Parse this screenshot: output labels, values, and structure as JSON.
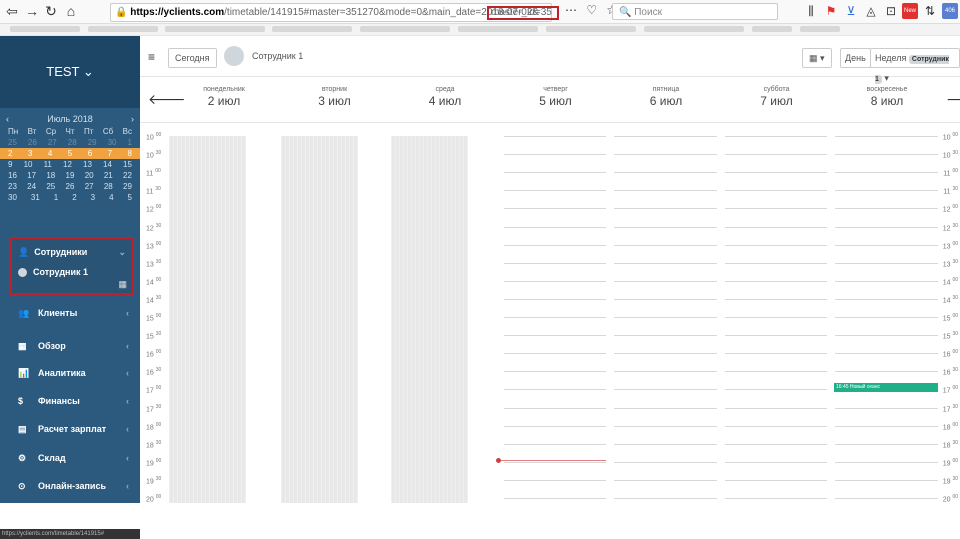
{
  "browser": {
    "url_domain": "https://yclients.com",
    "url_path": "/timetable/141915#master=351270&mode=0&main_date=2018-07-02&",
    "url_highlight": "master_id=35",
    "search_placeholder": "Поиск",
    "new_badge": "New",
    "count_badge": "406"
  },
  "sidebar": {
    "brand": "TEST ⌄",
    "calendar": {
      "month": "Июль 2018",
      "prev": "‹",
      "next": "›",
      "weekdays": [
        "Пн",
        "Вт",
        "Ср",
        "Чт",
        "Пт",
        "Сб",
        "Вс"
      ],
      "weeks": [
        {
          "days": [
            "25",
            "26",
            "27",
            "28",
            "29",
            "30",
            "1"
          ],
          "style": "dim"
        },
        {
          "days": [
            "2",
            "3",
            "4",
            "5",
            "6",
            "7",
            "8"
          ],
          "style": "current"
        },
        {
          "days": [
            "9",
            "10",
            "11",
            "12",
            "13",
            "14",
            "15"
          ],
          "style": ""
        },
        {
          "days": [
            "16",
            "17",
            "18",
            "19",
            "20",
            "21",
            "22"
          ],
          "style": ""
        },
        {
          "days": [
            "23",
            "24",
            "25",
            "26",
            "27",
            "28",
            "29"
          ],
          "style": ""
        },
        {
          "days": [
            "30",
            "31",
            "1",
            "2",
            "3",
            "4",
            "5"
          ],
          "style": ""
        }
      ]
    },
    "staff_header": "Сотрудники",
    "staff_member": "Сотрудник 1",
    "menu": [
      {
        "label": "Клиенты",
        "icon": "👥"
      },
      {
        "label": "Обзор",
        "icon": "▦"
      },
      {
        "label": "Аналитика",
        "icon": "📊"
      },
      {
        "label": "Финансы",
        "icon": "$"
      },
      {
        "label": "Расчет зарплат",
        "icon": "▤"
      },
      {
        "label": "Склад",
        "icon": "⚙"
      },
      {
        "label": "Онлайн-запись",
        "icon": "⊙"
      }
    ],
    "status_url": "https://yclients.com/timetable/141915#"
  },
  "toolbar": {
    "today": "Сегодня",
    "staff_name": "Сотрудник 1",
    "calendar_btn": "▦ ▾",
    "day": "День",
    "week": "Неделя",
    "week_badge": "Сотрудник 1",
    "week_caret": "▾"
  },
  "days": [
    {
      "weekday": "понедельник",
      "date": "2 июл"
    },
    {
      "weekday": "вторник",
      "date": "3 июл"
    },
    {
      "weekday": "среда",
      "date": "4 июл"
    },
    {
      "weekday": "четверг",
      "date": "5 июл"
    },
    {
      "weekday": "пятница",
      "date": "6 июл"
    },
    {
      "weekday": "суббота",
      "date": "7 июл"
    },
    {
      "weekday": "воскресенье",
      "date": "8 июл"
    }
  ],
  "times": [
    {
      "h": "10",
      "m": "00"
    },
    {
      "h": "10",
      "m": "30"
    },
    {
      "h": "11",
      "m": "00"
    },
    {
      "h": "11",
      "m": "30"
    },
    {
      "h": "12",
      "m": "00"
    },
    {
      "h": "12",
      "m": "30"
    },
    {
      "h": "13",
      "m": "00"
    },
    {
      "h": "13",
      "m": "30"
    },
    {
      "h": "14",
      "m": "00"
    },
    {
      "h": "14",
      "m": "30"
    },
    {
      "h": "15",
      "m": "00"
    },
    {
      "h": "15",
      "m": "30"
    },
    {
      "h": "16",
      "m": "00"
    },
    {
      "h": "16",
      "m": "30"
    },
    {
      "h": "17",
      "m": "00"
    },
    {
      "h": "17",
      "m": "30"
    },
    {
      "h": "18",
      "m": "00"
    },
    {
      "h": "18",
      "m": "30"
    },
    {
      "h": "19",
      "m": "00"
    },
    {
      "h": "19",
      "m": "30"
    },
    {
      "h": "20",
      "m": "00"
    }
  ],
  "event": {
    "label": "16:45 Новый сеанс"
  }
}
